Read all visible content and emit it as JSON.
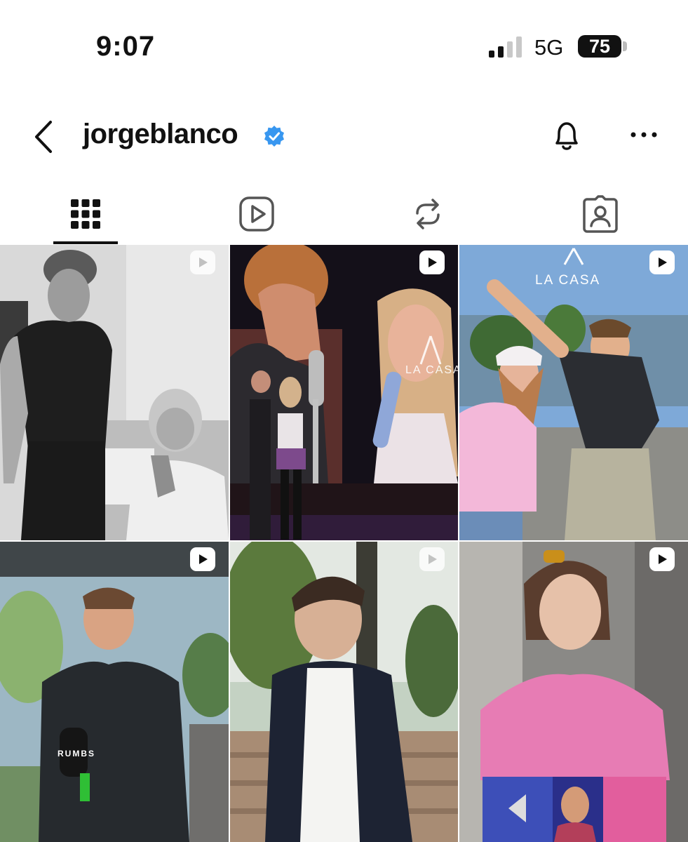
{
  "status_bar": {
    "time": "9:07",
    "network": "5G",
    "battery": "75"
  },
  "header": {
    "username": "jorgeblanco",
    "back_icon": "chevron-left-icon",
    "verified_icon": "verified-badge-icon",
    "bell_icon": "bell-icon",
    "more_icon": "more-horizontal-icon"
  },
  "tabs": [
    {
      "name": "posts-grid",
      "icon": "grid-icon",
      "selected": true
    },
    {
      "name": "reels",
      "icon": "reels-play-icon",
      "selected": false
    },
    {
      "name": "reposts",
      "icon": "repost-icon",
      "selected": false
    },
    {
      "name": "tagged",
      "icon": "tagged-person-icon",
      "selected": false
    }
  ],
  "posts": [
    {
      "type": "reel",
      "badge_icon": "reel-icon"
    },
    {
      "type": "reel",
      "badge_icon": "reel-icon",
      "watermark": "LA CASA"
    },
    {
      "type": "reel",
      "badge_icon": "reel-icon",
      "watermark": "LA CASA"
    },
    {
      "type": "reel",
      "badge_icon": "reel-icon",
      "mic_text": "RUMBS"
    },
    {
      "type": "reel",
      "badge_icon": "reel-icon"
    },
    {
      "type": "reel",
      "badge_icon": "reel-icon"
    }
  ],
  "colors": {
    "verified_blue": "#3897f0",
    "text": "#111111",
    "tab_icon": "#555555"
  }
}
